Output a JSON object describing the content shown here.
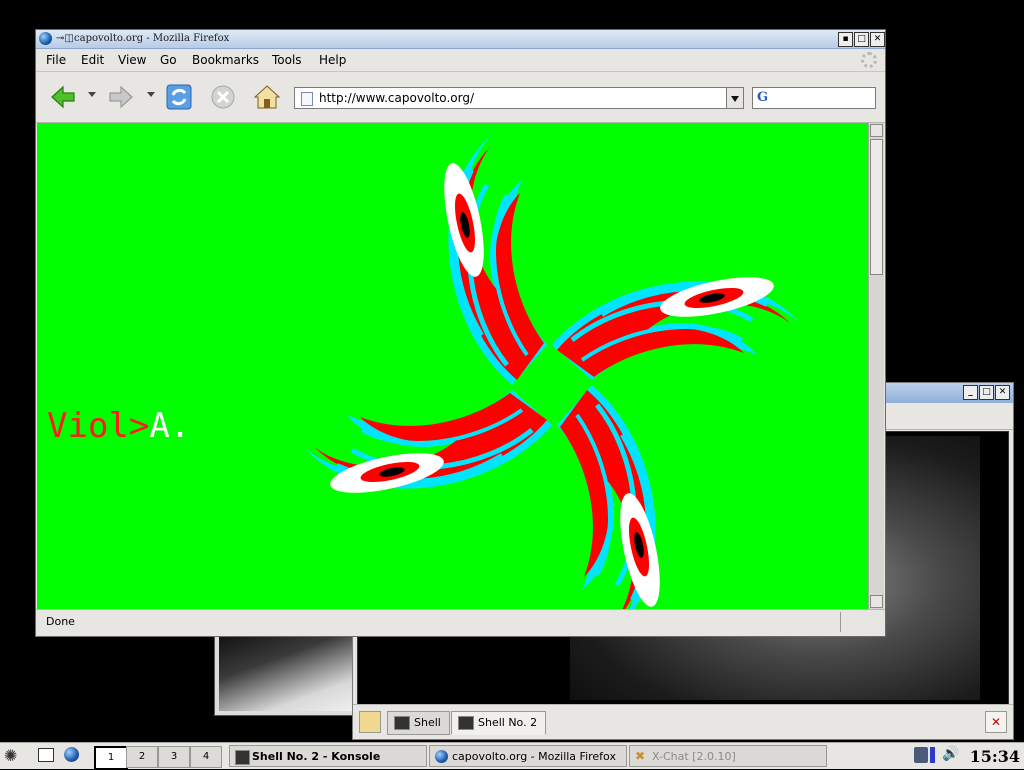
{
  "firefox": {
    "window_title": "capovolto.org - Mozilla Firefox",
    "menus": [
      "File",
      "Edit",
      "View",
      "Go",
      "Bookmarks",
      "Tools",
      "Help"
    ],
    "url": "http://www.capovolto.org/",
    "search_placeholder": "",
    "search_engine_icon": "google-icon",
    "page_text_red": "Viol>",
    "page_text_white": "A.",
    "status": "Done",
    "colors": {
      "page_bg": "#00ff00",
      "swirl_red": "#ff0000",
      "swirl_cyan": "#00e5ff"
    }
  },
  "konsole": {
    "tabs": [
      "Shell",
      "Shell No. 2"
    ],
    "active_tab": "Shell No. 2"
  },
  "taskbar": {
    "desktops": [
      "1",
      "2",
      "3",
      "4"
    ],
    "active_desktop": "1",
    "tasks": [
      {
        "label": "Shell No. 2 - Konsole",
        "icon": "terminal-icon"
      },
      {
        "label": "capovolto.org - Mozilla Firefox",
        "icon": "firefox-icon"
      },
      {
        "label": "X-Chat [2.0.10]",
        "icon": "xchat-icon"
      }
    ],
    "clock": "15:34"
  }
}
